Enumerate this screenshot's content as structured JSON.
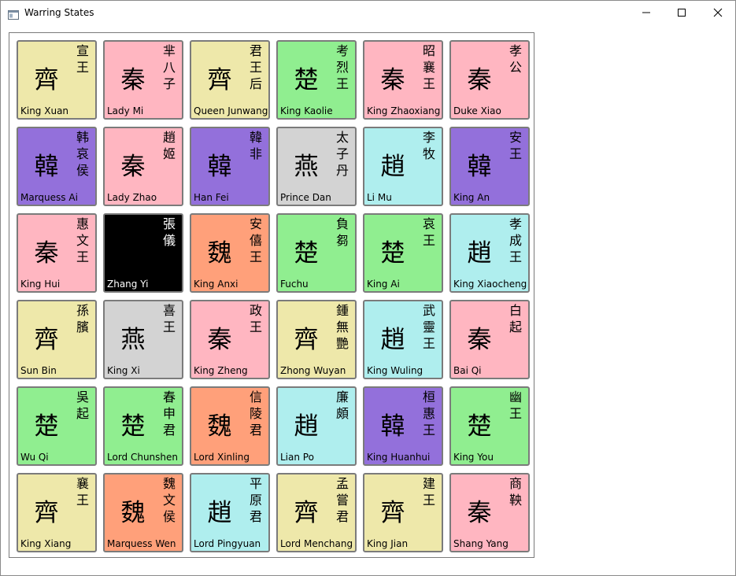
{
  "window": {
    "title": "Warring States"
  },
  "colors": {
    "qin": "#ffb6c1",
    "qi": "#eee8aa",
    "chu": "#90ee90",
    "han": "#9370db",
    "yan": "#d3d3d3",
    "zhao": "#afeeee",
    "wei": "#ffa07a",
    "selected": "#000000"
  },
  "tiles": [
    {
      "state": "齊",
      "chinese": "宣王",
      "english": "King Xuan",
      "color": "#eee8aa"
    },
    {
      "state": "秦",
      "chinese": "芈八子",
      "english": "Lady Mi",
      "color": "#ffb6c1"
    },
    {
      "state": "齊",
      "chinese": "君王后",
      "english": "Queen Junwang",
      "color": "#eee8aa"
    },
    {
      "state": "楚",
      "chinese": "考烈王",
      "english": "King Kaolie",
      "color": "#90ee90"
    },
    {
      "state": "秦",
      "chinese": "昭襄王",
      "english": "King Zhaoxiang",
      "color": "#ffb6c1"
    },
    {
      "state": "秦",
      "chinese": "孝公",
      "english": "Duke Xiao",
      "color": "#ffb6c1"
    },
    {
      "state": "韓",
      "chinese": "韩哀侯",
      "english": "Marquess Ai",
      "color": "#9370db"
    },
    {
      "state": "秦",
      "chinese": "趙姬",
      "english": "Lady Zhao",
      "color": "#ffb6c1"
    },
    {
      "state": "韓",
      "chinese": "韓非",
      "english": "Han Fei",
      "color": "#9370db"
    },
    {
      "state": "燕",
      "chinese": "太子丹",
      "english": "Prince Dan",
      "color": "#d3d3d3"
    },
    {
      "state": "趙",
      "chinese": "李牧",
      "english": "Li Mu",
      "color": "#afeeee"
    },
    {
      "state": "韓",
      "chinese": "安王",
      "english": "King An",
      "color": "#9370db"
    },
    {
      "state": "秦",
      "chinese": "惠文王",
      "english": "King Hui",
      "color": "#ffb6c1"
    },
    {
      "state": "",
      "chinese": "張儀",
      "english": "Zhang Yi",
      "color": "#000000",
      "selected": true
    },
    {
      "state": "魏",
      "chinese": "安僖王",
      "english": "King Anxi",
      "color": "#ffa07a"
    },
    {
      "state": "楚",
      "chinese": "負芻",
      "english": "Fuchu",
      "color": "#90ee90"
    },
    {
      "state": "楚",
      "chinese": "哀王",
      "english": "King Ai",
      "color": "#90ee90"
    },
    {
      "state": "趙",
      "chinese": "孝成王",
      "english": "King Xiaocheng",
      "color": "#afeeee"
    },
    {
      "state": "齊",
      "chinese": "孫臏",
      "english": "Sun Bin",
      "color": "#eee8aa"
    },
    {
      "state": "燕",
      "chinese": "喜王",
      "english": "King Xi",
      "color": "#d3d3d3"
    },
    {
      "state": "秦",
      "chinese": "政王",
      "english": "King Zheng",
      "color": "#ffb6c1"
    },
    {
      "state": "齊",
      "chinese": "鍾無艷",
      "english": "Zhong Wuyan",
      "color": "#eee8aa"
    },
    {
      "state": "趙",
      "chinese": "武靈王",
      "english": "King Wuling",
      "color": "#afeeee"
    },
    {
      "state": "秦",
      "chinese": "白起",
      "english": "Bai Qi",
      "color": "#ffb6c1"
    },
    {
      "state": "楚",
      "chinese": "吳起",
      "english": "Wu Qi",
      "color": "#90ee90"
    },
    {
      "state": "楚",
      "chinese": "春申君",
      "english": "Lord Chunshen",
      "color": "#90ee90"
    },
    {
      "state": "魏",
      "chinese": "信陵君",
      "english": "Lord Xinling",
      "color": "#ffa07a"
    },
    {
      "state": "趙",
      "chinese": "廉頗",
      "english": "Lian Po",
      "color": "#afeeee"
    },
    {
      "state": "韓",
      "chinese": "桓惠王",
      "english": "King Huanhui",
      "color": "#9370db"
    },
    {
      "state": "楚",
      "chinese": "幽王",
      "english": "King You",
      "color": "#90ee90"
    },
    {
      "state": "齊",
      "chinese": "襄王",
      "english": "King Xiang",
      "color": "#eee8aa"
    },
    {
      "state": "魏",
      "chinese": "魏文侯",
      "english": "Marquess Wen",
      "color": "#ffa07a"
    },
    {
      "state": "趙",
      "chinese": "平原君",
      "english": "Lord Pingyuan",
      "color": "#afeeee"
    },
    {
      "state": "齊",
      "chinese": "孟嘗君",
      "english": "Lord Menchang",
      "color": "#eee8aa"
    },
    {
      "state": "齊",
      "chinese": "建王",
      "english": "King Jian",
      "color": "#eee8aa"
    },
    {
      "state": "秦",
      "chinese": "商鞅",
      "english": "Shang Yang",
      "color": "#ffb6c1"
    }
  ]
}
